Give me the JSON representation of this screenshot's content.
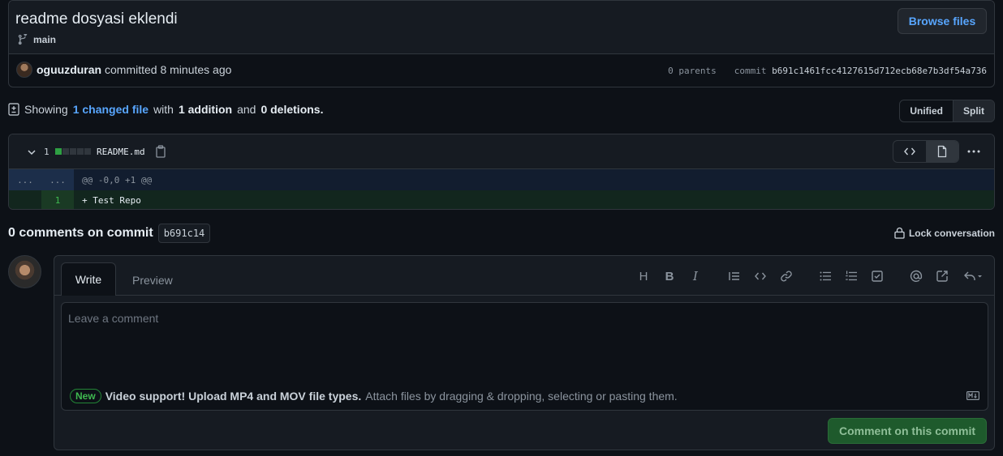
{
  "commit": {
    "title": "readme dosyasi eklendi",
    "branch": "main",
    "browse_label": "Browse files",
    "author": "oguuzduran",
    "committed_text": "committed 8 minutes ago",
    "parents": "0 parents",
    "commit_label": "commit",
    "sha": "b691c1461fcc4127615d712ecb68e7b3df54a736"
  },
  "summary": {
    "showing": "Showing",
    "changed": "1 changed file",
    "with": "with",
    "additions": "1 addition",
    "and": "and",
    "deletions": "0 deletions.",
    "unified": "Unified",
    "split": "Split"
  },
  "diff": {
    "count": "1",
    "filename": "README.md",
    "hunk_ln_left": "...",
    "hunk_ln_right": "...",
    "hunk_header": "@@ -0,0 +1 @@",
    "added_line_number": "1",
    "added_line": "+ Test Repo"
  },
  "comments": {
    "heading": "0 comments on commit",
    "short_sha": "b691c14",
    "lock_label": "Lock conversation"
  },
  "form": {
    "write_tab": "Write",
    "preview_tab": "Preview",
    "placeholder": "Leave a comment",
    "new_badge": "New",
    "video_support": "Video support! Upload MP4 and MOV file types.",
    "attach_hint": "Attach files by dragging & dropping, selecting or pasting them.",
    "submit_label": "Comment on this commit",
    "toolbar": {
      "heading": "H",
      "bold": "B",
      "italic": "I"
    }
  }
}
